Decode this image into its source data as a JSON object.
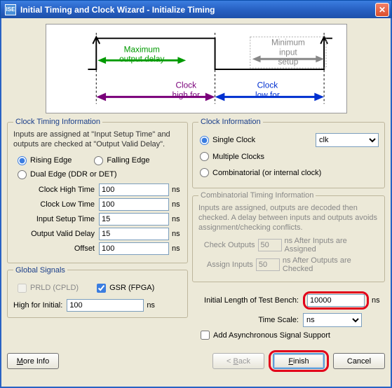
{
  "titlebar": {
    "title": "Initial Timing and Clock Wizard - Initialize Timing"
  },
  "diagram": {
    "max_out_delay_l1": "Maximum",
    "max_out_delay_l2": "output delay",
    "min_input_setup_l1": "Minimum",
    "min_input_setup_l2": "input",
    "min_input_setup_l3": "setup",
    "clock_high_l1": "Clock",
    "clock_high_l2": "high for",
    "clock_low_l1": "Clock",
    "clock_low_l2": "low for"
  },
  "clock_timing": {
    "legend": "Clock Timing Information",
    "desc": "Inputs are assigned at \"Input Setup Time\" and outputs are checked at \"Output Valid Delay\".",
    "rising_edge": "Rising Edge",
    "falling_edge": "Falling Edge",
    "dual_edge": "Dual Edge (DDR or DET)",
    "clock_high_label": "Clock High Time",
    "clock_high_value": "100",
    "clock_low_label": "Clock Low Time",
    "clock_low_value": "100",
    "input_setup_label": "Input Setup Time",
    "input_setup_value": "15",
    "output_valid_label": "Output Valid Delay",
    "output_valid_value": "15",
    "offset_label": "Offset",
    "offset_value": "100",
    "unit_ns": "ns"
  },
  "global_signals": {
    "legend": "Global Signals",
    "prld": "PRLD (CPLD)",
    "gsr": "GSR (FPGA)",
    "high_for_label": "High for Initial:",
    "high_for_value": "100",
    "unit_ns": "ns"
  },
  "clock_info": {
    "legend": "Clock Information",
    "single": "Single Clock",
    "single_value": "clk",
    "multiple": "Multiple Clocks",
    "combinatorial": "Combinatorial (or internal clock)"
  },
  "comb_timing": {
    "legend": "Combinatorial Timing Information",
    "desc": "Inputs are assigned, outputs are decoded then checked.  A delay between inputs and outputs avoids assignment/checking conflicts.",
    "check_outputs_label": "Check Outputs",
    "check_outputs_value": "50",
    "check_outputs_suffix": "ns  After Inputs are Assigned",
    "assign_inputs_label": "Assign Inputs",
    "assign_inputs_value": "50",
    "assign_inputs_suffix": "ns  After Outputs are Checked"
  },
  "test_bench": {
    "len_label": "Initial Length of Test Bench:",
    "len_value": "10000",
    "len_unit": "ns",
    "scale_label": "Time Scale:",
    "scale_value": "ns",
    "async_label": "Add Asynchronous Signal Support"
  },
  "buttons": {
    "more_info": "More Info",
    "back": "< Back",
    "finish": "Finish",
    "cancel": "Cancel"
  }
}
